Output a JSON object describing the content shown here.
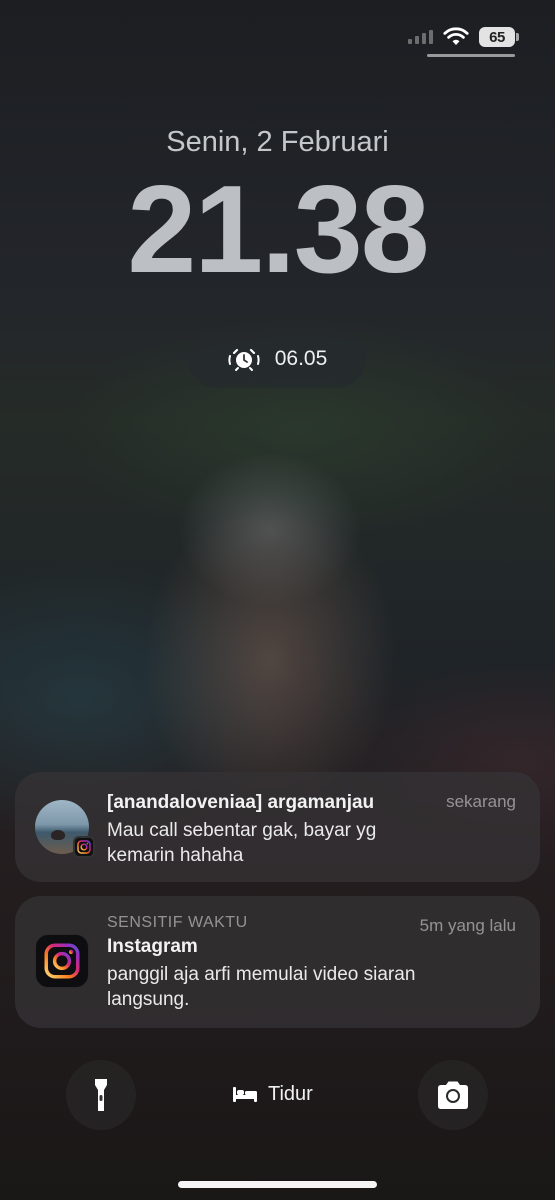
{
  "status_bar": {
    "battery_level": "65",
    "signal_icon": "cellular-signal-icon",
    "wifi_icon": "wifi-icon"
  },
  "lock_screen": {
    "date": "Senin, 2 Februari",
    "time": "21.38",
    "alarm": {
      "icon": "alarm-clock-icon",
      "time": "06.05"
    }
  },
  "notifications": [
    {
      "app_icon": "instagram-icon",
      "title": "[anandaloveniaa] argamanjau",
      "time": "sekarang",
      "body": "Mau call sebentar gak, bayar yg kemarin hahaha"
    },
    {
      "app_icon": "instagram-icon",
      "caption": "SENSITIF WAKTU",
      "title": "Instagram",
      "time": "5m yang lalu",
      "body": "panggil aja arfi memulai video siaran langsung."
    }
  ],
  "bottom_bar": {
    "flashlight_icon": "flashlight-icon",
    "focus_label": "Tidur",
    "focus_icon": "bed-icon",
    "camera_icon": "camera-icon"
  },
  "colors": {
    "notification_bg": "#343234",
    "text_primary": "#f2f2f2",
    "text_secondary": "#a6a6a6",
    "instagram_gradient": [
      "#feda75",
      "#fa7e1e",
      "#d62976",
      "#962fbf",
      "#4f5bd5"
    ]
  }
}
